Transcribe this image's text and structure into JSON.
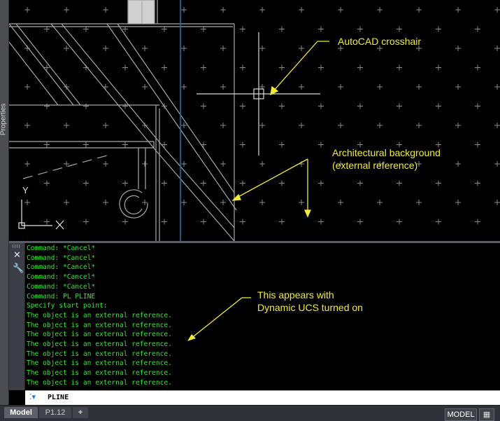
{
  "palette": {
    "annotation": "#f2ea3a",
    "command_text": "#35e335",
    "xref_lines": "#a8a8a8",
    "column_line": "#1f6fa0",
    "canvas": "#000000"
  },
  "sidebar": {
    "properties_label": "Properties",
    "icon": "properties-palette-icon"
  },
  "viewport": {
    "icons": [
      "grid-plus-marker",
      "ucs-icon",
      "crosshair-cursor"
    ],
    "ucs_label": "Y"
  },
  "annotations": {
    "crosshair": "AutoCAD crosshair",
    "background_line1": "Architectural background",
    "background_line2": "(external reference)",
    "dynucs_line1": "This appears with",
    "dynucs_line2": "Dynamic UCS turned on"
  },
  "command_window": {
    "icons": [
      "close-icon",
      "wrench-icon"
    ],
    "history": [
      "Command: *Cancel*",
      "Command: *Cancel*",
      "Command: *Cancel*",
      "Command: *Cancel*",
      "Command: *Cancel*",
      "Command: PL PLINE",
      "Specify start point:",
      "The object is an external reference.",
      "The object is an external reference.",
      "The object is an external reference.",
      "The object is an external reference.",
      "The object is an external reference.",
      "The object is an external reference.",
      "The object is an external reference.",
      "The object is an external reference."
    ],
    "prompt_icon": "command-prompt-icon",
    "input_value": "PLINE"
  },
  "statusbar": {
    "tabs": [
      "Model",
      "P1.12",
      "+"
    ],
    "active_tab": "Model",
    "space_label": "MODEL",
    "grid_icon": "grid-display-icon"
  }
}
